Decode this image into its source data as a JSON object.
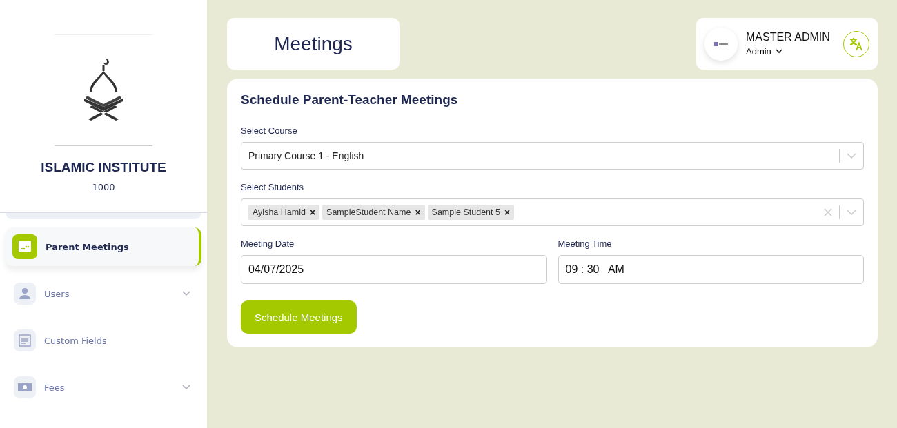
{
  "sidebar": {
    "institute_name": "ISLAMIC INSTITUTE",
    "institute_code": "1000",
    "items": [
      {
        "label": "Parent Meetings",
        "kind": "calendar",
        "selected": true,
        "expandable": false
      },
      {
        "label": "Users",
        "kind": "user",
        "selected": false,
        "expandable": true
      },
      {
        "label": "Custom Fields",
        "kind": "form",
        "selected": false,
        "expandable": false
      },
      {
        "label": "Fees",
        "kind": "money",
        "selected": false,
        "expandable": true
      }
    ]
  },
  "page_title": "Meetings",
  "user": {
    "name": "MASTER ADMIN",
    "role": "Admin"
  },
  "form": {
    "title": "Schedule Parent-Teacher Meetings",
    "course": {
      "label": "Select Course",
      "value": "Primary Course 1 - English"
    },
    "students": {
      "label": "Select Students",
      "tags": [
        "Ayisha Hamid",
        "SampleStudent Name",
        "Sample Student 5"
      ],
      "remove_glyph": "×"
    },
    "date": {
      "label": "Meeting Date",
      "value": "04/07/2025"
    },
    "time": {
      "label": "Meeting Time",
      "value": "09 : 30   AM"
    },
    "submit": "Schedule Meetings"
  }
}
